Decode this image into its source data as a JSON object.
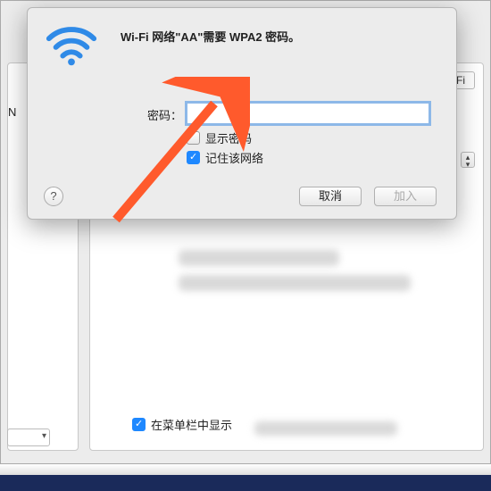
{
  "dialog": {
    "title": "Wi-Fi 网络\"AA\"需要 WPA2 密码。",
    "password_label": "密码：",
    "password_value": "",
    "show_password_label": "显示密码",
    "remember_label": "记住该网络",
    "help_label": "?",
    "cancel_label": "取消",
    "join_label": "加入"
  },
  "background": {
    "wifi_badge": "Wi-Fi",
    "left_char": "N",
    "menubar_label": "在菜单栏中显示"
  }
}
